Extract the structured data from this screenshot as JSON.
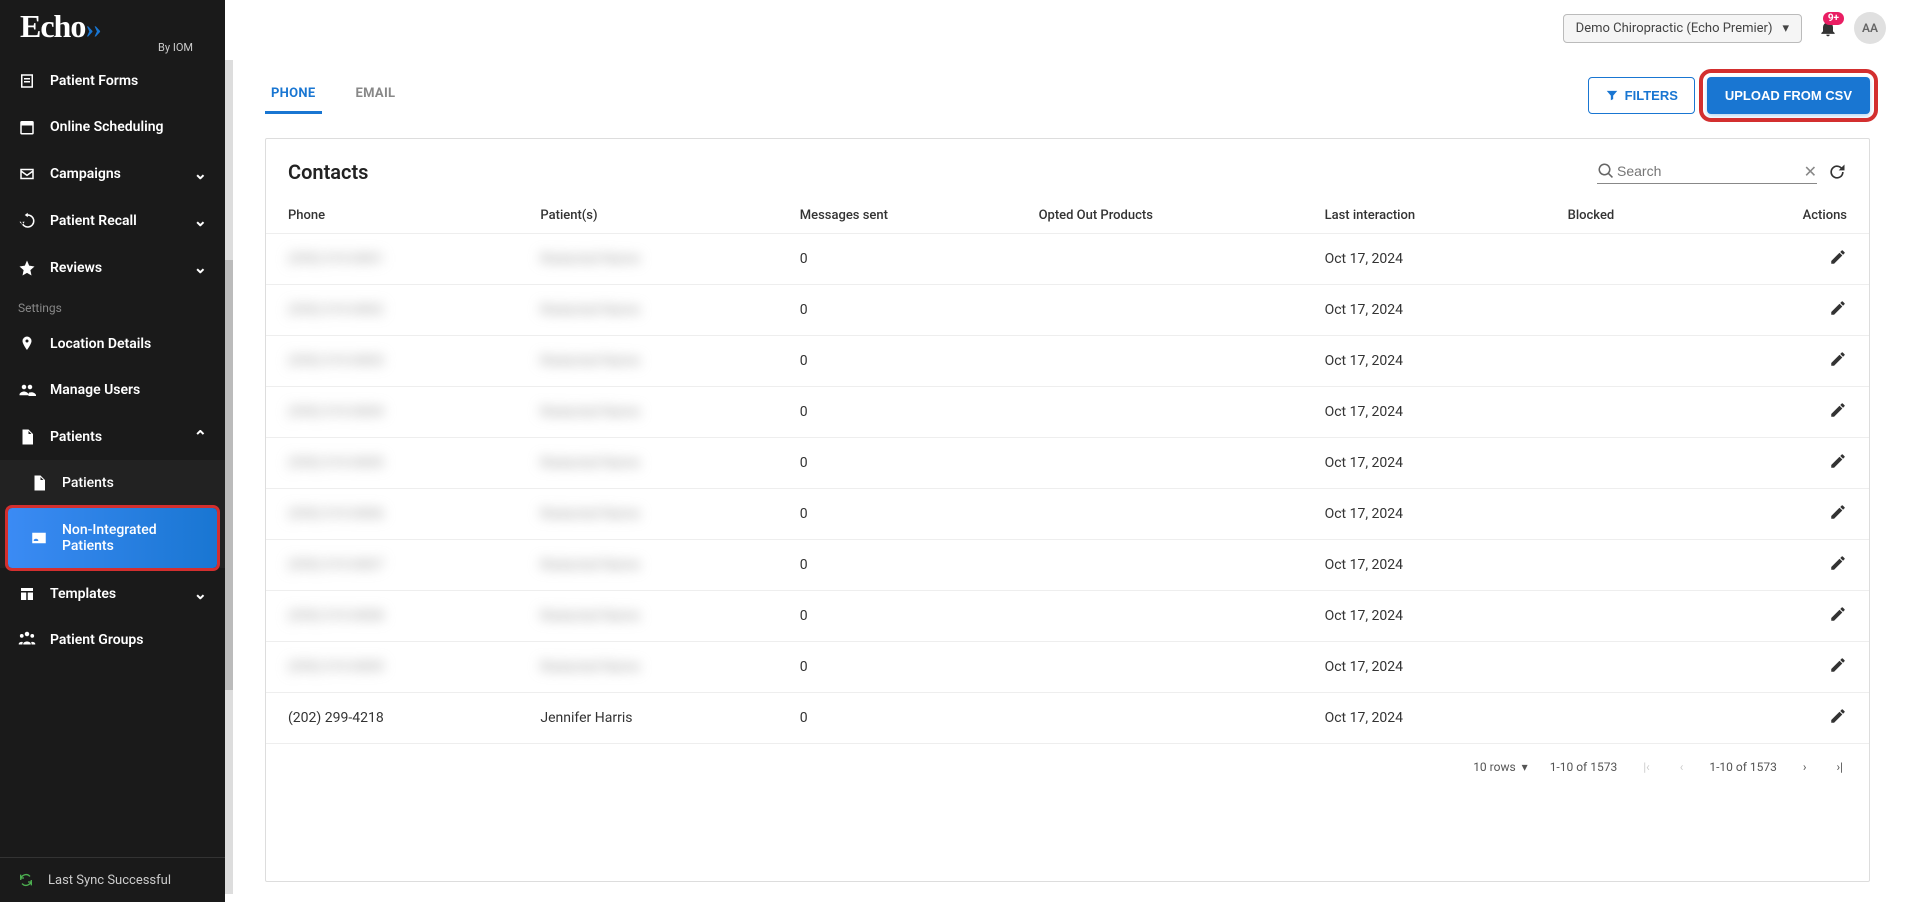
{
  "brand": {
    "name": "Echo",
    "byline": "By IOM"
  },
  "sidebar": {
    "items": [
      {
        "label": "Patient Forms",
        "icon": "form-icon"
      },
      {
        "label": "Online Scheduling",
        "icon": "calendar-icon"
      },
      {
        "label": "Campaigns",
        "icon": "mail-icon",
        "expandable": true
      },
      {
        "label": "Patient Recall",
        "icon": "history-icon",
        "expandable": true
      },
      {
        "label": "Reviews",
        "icon": "star-icon",
        "expandable": true
      }
    ],
    "section_label": "Settings",
    "settings": [
      {
        "label": "Location Details",
        "icon": "location-icon"
      },
      {
        "label": "Manage Users",
        "icon": "users-icon"
      },
      {
        "label": "Patients",
        "icon": "file-icon",
        "expandable": true,
        "expanded": true,
        "children": [
          {
            "label": "Patients",
            "icon": "file-icon"
          },
          {
            "label": "Non-Integrated Patients",
            "icon": "contact-card-icon",
            "active": true,
            "highlight": true
          }
        ]
      },
      {
        "label": "Templates",
        "icon": "templates-icon",
        "expandable": true
      },
      {
        "label": "Patient Groups",
        "icon": "group-icon"
      }
    ],
    "sync_text": "Last Sync Successful"
  },
  "header": {
    "practice": "Demo Chiropractic (Echo Premier)",
    "notif_badge": "9+",
    "avatar_initials": "AA"
  },
  "tabs": {
    "phone": "PHONE",
    "email": "EMAIL"
  },
  "actions": {
    "filters": "FILTERS",
    "upload": "UPLOAD FROM CSV"
  },
  "panel": {
    "title": "Contacts",
    "search_placeholder": "Search",
    "columns": [
      "Phone",
      "Patient(s)",
      "Messages sent",
      "Opted Out Products",
      "Last interaction",
      "Blocked",
      "Actions"
    ]
  },
  "rows": [
    {
      "phone": "(555) 010-0001",
      "patient": "Redacted Name",
      "messages": "0",
      "opted": "",
      "last": "Oct 17, 2024",
      "blocked": "",
      "blurred": true
    },
    {
      "phone": "(555) 010-0002",
      "patient": "Redacted Name",
      "messages": "0",
      "opted": "",
      "last": "Oct 17, 2024",
      "blocked": "",
      "blurred": true
    },
    {
      "phone": "(555) 010-0003",
      "patient": "Redacted Name",
      "messages": "0",
      "opted": "",
      "last": "Oct 17, 2024",
      "blocked": "",
      "blurred": true
    },
    {
      "phone": "(555) 010-0004",
      "patient": "Redacted Name",
      "messages": "0",
      "opted": "",
      "last": "Oct 17, 2024",
      "blocked": "",
      "blurred": true
    },
    {
      "phone": "(555) 010-0005",
      "patient": "Redacted Name",
      "messages": "0",
      "opted": "",
      "last": "Oct 17, 2024",
      "blocked": "",
      "blurred": true
    },
    {
      "phone": "(555) 010-0006",
      "patient": "Redacted Name",
      "messages": "0",
      "opted": "",
      "last": "Oct 17, 2024",
      "blocked": "",
      "blurred": true
    },
    {
      "phone": "(555) 010-0007",
      "patient": "Redacted Name",
      "messages": "0",
      "opted": "",
      "last": "Oct 17, 2024",
      "blocked": "",
      "blurred": true
    },
    {
      "phone": "(555) 010-0008",
      "patient": "Redacted Name",
      "messages": "0",
      "opted": "",
      "last": "Oct 17, 2024",
      "blocked": "",
      "blurred": true
    },
    {
      "phone": "(555) 010-0009",
      "patient": "Redacted Name",
      "messages": "0",
      "opted": "",
      "last": "Oct 17, 2024",
      "blocked": "",
      "blurred": true
    },
    {
      "phone": "(202) 299-4218",
      "patient": "Jennifer Harris",
      "messages": "0",
      "opted": "",
      "last": "Oct 17, 2024",
      "blocked": "",
      "blurred": false
    }
  ],
  "paginator": {
    "rows_label": "10 rows",
    "range1": "1-10 of 1573",
    "range2": "1-10 of 1573"
  }
}
